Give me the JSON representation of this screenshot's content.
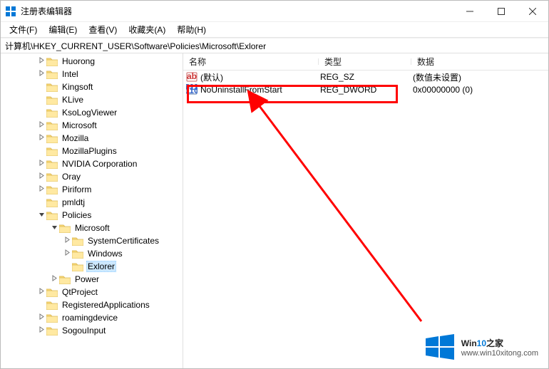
{
  "window": {
    "title": "注册表编辑器"
  },
  "menu": {
    "file": "文件(F)",
    "edit": "编辑(E)",
    "view": "查看(V)",
    "favorites": "收藏夹(A)",
    "help": "帮助(H)"
  },
  "address": {
    "path": "计算机\\HKEY_CURRENT_USER\\Software\\Policies\\Microsoft\\Exlorer"
  },
  "columns": {
    "name": "名称",
    "type": "类型",
    "data": "数据"
  },
  "rows": [
    {
      "icon": "ab",
      "name": "(默认)",
      "type": "REG_SZ",
      "data": "(数值未设置)"
    },
    {
      "icon": "bin",
      "name": "NoUninstallFromStart",
      "type": "REG_DWORD",
      "data": "0x00000000 (0)"
    }
  ],
  "tree": [
    {
      "depth": 0,
      "expand": "closed",
      "label": "Huorong"
    },
    {
      "depth": 0,
      "expand": "closed",
      "label": "Intel"
    },
    {
      "depth": 0,
      "expand": "none",
      "label": "Kingsoft"
    },
    {
      "depth": 0,
      "expand": "none",
      "label": "KLive"
    },
    {
      "depth": 0,
      "expand": "none",
      "label": "KsoLogViewer"
    },
    {
      "depth": 0,
      "expand": "closed",
      "label": "Microsoft"
    },
    {
      "depth": 0,
      "expand": "closed",
      "label": "Mozilla"
    },
    {
      "depth": 0,
      "expand": "none",
      "label": "MozillaPlugins"
    },
    {
      "depth": 0,
      "expand": "closed",
      "label": "NVIDIA Corporation"
    },
    {
      "depth": 0,
      "expand": "closed",
      "label": "Oray"
    },
    {
      "depth": 0,
      "expand": "closed",
      "label": "Piriform"
    },
    {
      "depth": 0,
      "expand": "none",
      "label": "pmldtj"
    },
    {
      "depth": 0,
      "expand": "open",
      "label": "Policies"
    },
    {
      "depth": 1,
      "expand": "open",
      "label": "Microsoft"
    },
    {
      "depth": 2,
      "expand": "closed",
      "label": "SystemCertificates"
    },
    {
      "depth": 2,
      "expand": "closed",
      "label": "Windows"
    },
    {
      "depth": 2,
      "expand": "none",
      "label": "Exlorer",
      "selected": true
    },
    {
      "depth": 1,
      "expand": "closed",
      "label": "Power"
    },
    {
      "depth": 0,
      "expand": "closed",
      "label": "QtProject"
    },
    {
      "depth": 0,
      "expand": "none",
      "label": "RegisteredApplications"
    },
    {
      "depth": 0,
      "expand": "closed",
      "label": "roamingdevice"
    },
    {
      "depth": 0,
      "expand": "closed",
      "label": "SogouInput"
    }
  ],
  "watermark": {
    "line1a": "Win",
    "line1b": "10",
    "line1c": "之家",
    "line2": "www.win10xitong.com"
  }
}
